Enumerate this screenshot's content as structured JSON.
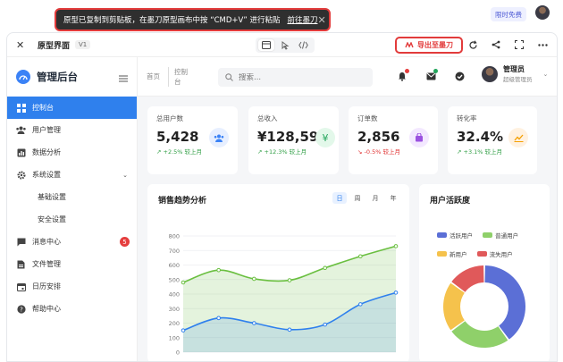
{
  "toast": {
    "message": "原型已复制到剪贴板，在墨刀原型画布中按 “CMD+V” 进行粘贴",
    "link": "前往墨刀"
  },
  "promo": "限时免费",
  "frame": {
    "title": "原型界面",
    "version": "V1",
    "export_label": "导出至墨刀"
  },
  "sidebar": {
    "brand": "管理后台",
    "items": [
      {
        "label": "控制台",
        "icon": "dashboard-icon",
        "active": true
      },
      {
        "label": "用户管理",
        "icon": "users-icon"
      },
      {
        "label": "数据分析",
        "icon": "bar-chart-icon"
      },
      {
        "label": "系统设置",
        "icon": "gear-icon",
        "expanded": true
      },
      {
        "label": "基础设置",
        "sub": true
      },
      {
        "label": "安全设置",
        "sub": true
      },
      {
        "label": "消息中心",
        "icon": "message-icon",
        "badge": "5"
      },
      {
        "label": "文件管理",
        "icon": "file-icon"
      },
      {
        "label": "日历安排",
        "icon": "calendar-icon"
      },
      {
        "label": "帮助中心",
        "icon": "help-icon"
      }
    ]
  },
  "header": {
    "breadcrumb": [
      "首页",
      "控制台"
    ],
    "search_placeholder": "搜索...",
    "user_name": "管理员",
    "user_role": "超级管理员"
  },
  "stats": [
    {
      "label": "总用户数",
      "value": "5,428",
      "trend": "+2.5% 较上月",
      "trend_color": "#2f9e44",
      "icon_bg": "#e7efff",
      "icon_color": "#3b82f6"
    },
    {
      "label": "总收入",
      "value": "¥128,590",
      "trend": "+12.3% 较上月",
      "trend_color": "#2f9e44",
      "icon_bg": "#e3f8ea",
      "icon_color": "#22a55b"
    },
    {
      "label": "订单数",
      "value": "2,856",
      "trend": "-0.5% 较上月",
      "trend_color": "#e03131",
      "icon_bg": "#f3e8ff",
      "icon_color": "#9b51e0"
    },
    {
      "label": "转化率",
      "value": "32.4%",
      "trend": "+3.1% 较上月",
      "trend_color": "#2f9e44",
      "icon_bg": "#fff1e0",
      "icon_color": "#f59f00"
    }
  ],
  "sales_panel": {
    "title": "销售趋势分析",
    "ranges": [
      "日",
      "周",
      "月",
      "年"
    ],
    "active_range": "日"
  },
  "activity_panel": {
    "title": "用户活跃度"
  },
  "chart_data": [
    {
      "type": "line",
      "title": "销售趋势分析",
      "y_ticks": [
        0,
        100,
        200,
        300,
        400,
        500,
        600,
        700,
        800
      ],
      "ylim": [
        0,
        800
      ],
      "series": [
        {
          "values": [
            480,
            565,
            505,
            495,
            580,
            660,
            730
          ],
          "color": "#6abf40"
        },
        {
          "values": [
            150,
            235,
            200,
            155,
            190,
            330,
            410
          ],
          "color": "#2f80ed"
        }
      ]
    },
    {
      "type": "pie",
      "title": "用户活跃度",
      "legend": [
        "活跃用户",
        "普通用户",
        "新用户",
        "流失用户"
      ],
      "values": [
        40,
        25,
        20,
        15
      ],
      "colors": [
        "#5b6fd6",
        "#8fd06a",
        "#f5c24c",
        "#e0595a"
      ]
    }
  ]
}
